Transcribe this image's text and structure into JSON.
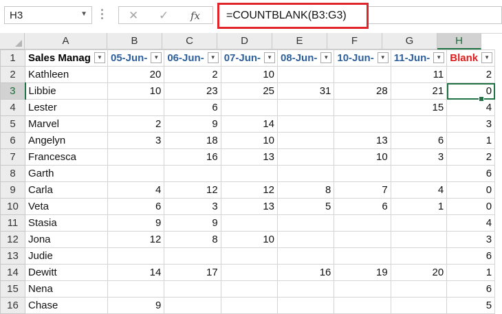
{
  "name_box": {
    "value": "H3"
  },
  "formula_bar": {
    "cancel_icon": "close-icon",
    "enter_icon": "check-icon",
    "function_label": "fx",
    "formula": "=COUNTBLANK(B3:G3)"
  },
  "columns": [
    "A",
    "B",
    "C",
    "D",
    "E",
    "F",
    "G",
    "H"
  ],
  "row_numbers": [
    "1",
    "2",
    "3",
    "4",
    "5",
    "6",
    "7",
    "8",
    "9",
    "10",
    "11",
    "12",
    "13",
    "14",
    "15",
    "16"
  ],
  "headers": [
    "Sales Manag",
    "05-Jun-",
    "06-Jun-",
    "07-Jun-",
    "08-Jun-",
    "10-Jun-",
    "11-Jun-",
    "Blank"
  ],
  "rows": [
    [
      "Kathleen",
      "20",
      "2",
      "10",
      "",
      "",
      "11",
      "2"
    ],
    [
      "Libbie",
      "10",
      "23",
      "25",
      "31",
      "28",
      "21",
      "0"
    ],
    [
      "Lester",
      "",
      "6",
      "",
      "",
      "",
      "15",
      "4"
    ],
    [
      "Marvel",
      "2",
      "9",
      "14",
      "",
      "",
      "",
      "3"
    ],
    [
      "Angelyn",
      "3",
      "18",
      "10",
      "",
      "13",
      "6",
      "1"
    ],
    [
      "Francesca",
      "",
      "16",
      "13",
      "",
      "10",
      "3",
      "2"
    ],
    [
      "Garth",
      "",
      "",
      "",
      "",
      "",
      "",
      "6"
    ],
    [
      "Carla",
      "4",
      "12",
      "12",
      "8",
      "7",
      "4",
      "0"
    ],
    [
      "Veta",
      "6",
      "3",
      "13",
      "5",
      "6",
      "1",
      "0"
    ],
    [
      "Stasia",
      "9",
      "9",
      "",
      "",
      "",
      "",
      "4"
    ],
    [
      "Jona",
      "12",
      "8",
      "10",
      "",
      "",
      "",
      "3"
    ],
    [
      "Judie",
      "",
      "",
      "",
      "",
      "",
      "",
      "6"
    ],
    [
      "Dewitt",
      "14",
      "17",
      "",
      "16",
      "19",
      "20",
      "1"
    ],
    [
      "Nena",
      "",
      "",
      "",
      "",
      "",
      "",
      "6"
    ],
    [
      "Chase",
      "9",
      "",
      "",
      "",
      "",
      "",
      "5"
    ]
  ],
  "colors": {
    "accent": "#1f7244",
    "highlight": "#e0242a",
    "header_text": "#2c5f9e",
    "blank_header": "#e01b1b"
  }
}
